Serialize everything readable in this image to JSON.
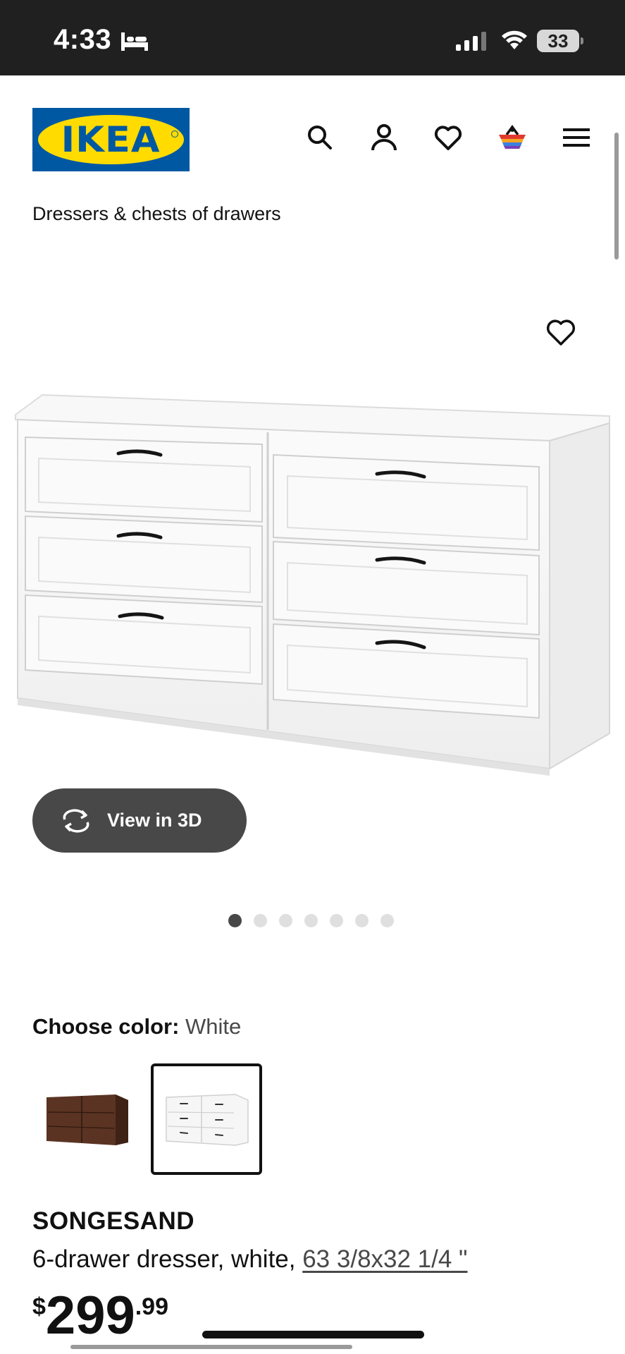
{
  "status_bar": {
    "time": "4:33",
    "battery": "33"
  },
  "header": {
    "logo_text": "IKEA",
    "icons": [
      "search-icon",
      "account-icon",
      "favourites-icon",
      "cart-icon",
      "menu-icon"
    ]
  },
  "breadcrumb": "Dressers & chests of drawers",
  "gallery": {
    "view3d_label": "View in 3D",
    "dot_count": 7,
    "active_dot": 1
  },
  "color_selector": {
    "label": "Choose color:",
    "value": "White",
    "options": [
      "Brown",
      "White"
    ],
    "selected_index": 1
  },
  "product": {
    "name": "SONGESAND",
    "description": "6-drawer dresser, white,",
    "size_link": "63 3/8x32 1/4 \"",
    "price": {
      "currency": "$",
      "integer": "299",
      "decimal": ".99"
    }
  },
  "colors": {
    "ikea_blue": "#0058a3",
    "ikea_yellow": "#ffdb00",
    "status_bar": "#202020",
    "button_dark": "#484848"
  }
}
